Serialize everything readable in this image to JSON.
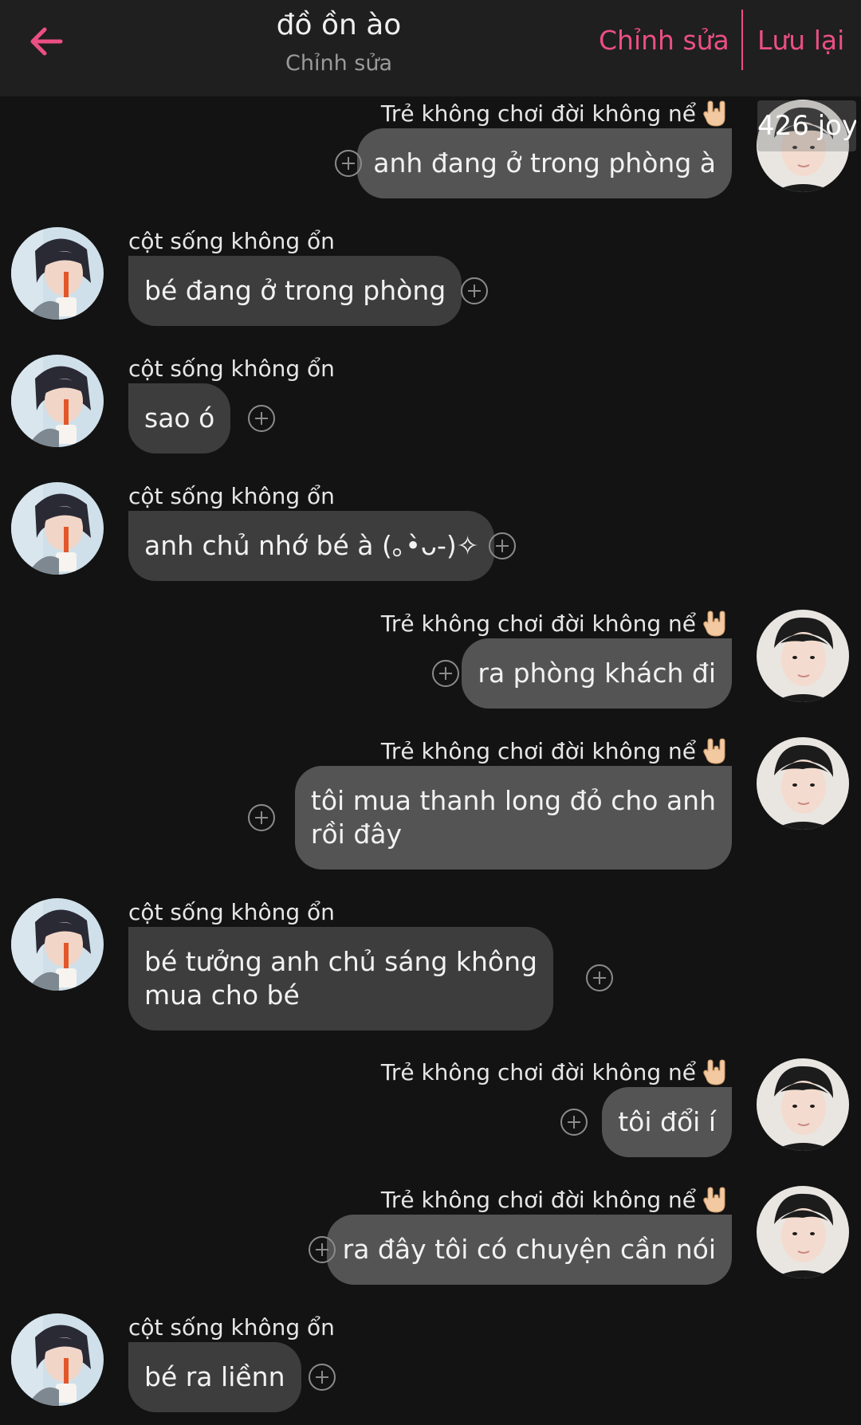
{
  "header": {
    "title": "đồ ồn ào",
    "subtitle": "Chỉnh sửa",
    "edit_label": "Chỉnh sửa",
    "save_label": "Lưu lại",
    "accent_color": "#ec4f83"
  },
  "overlay_tag": "426 joy",
  "names": {
    "left": "cột sống không ổn",
    "right": "Trẻ không chơi đời không nể"
  },
  "messages": [
    {
      "side": "right",
      "text": "anh đang ở trong phòng à"
    },
    {
      "side": "left",
      "text": "bé đang ở trong phòng"
    },
    {
      "side": "left",
      "text": "sao ó"
    },
    {
      "side": "left",
      "text": "anh chủ nhớ bé à (｡•̀ᴗ-)✧"
    },
    {
      "side": "right",
      "text": "ra phòng khách đi"
    },
    {
      "side": "right",
      "text": "tôi mua thanh long đỏ cho anh\nrồi đây"
    },
    {
      "side": "left",
      "text": "bé tưởng anh chủ sáng không\nmua cho bé"
    },
    {
      "side": "right",
      "text": "tôi đổi í"
    },
    {
      "side": "right",
      "text": "ra đây tôi có chuyện cần nói"
    },
    {
      "side": "left",
      "text": "bé ra liềnn"
    }
  ]
}
